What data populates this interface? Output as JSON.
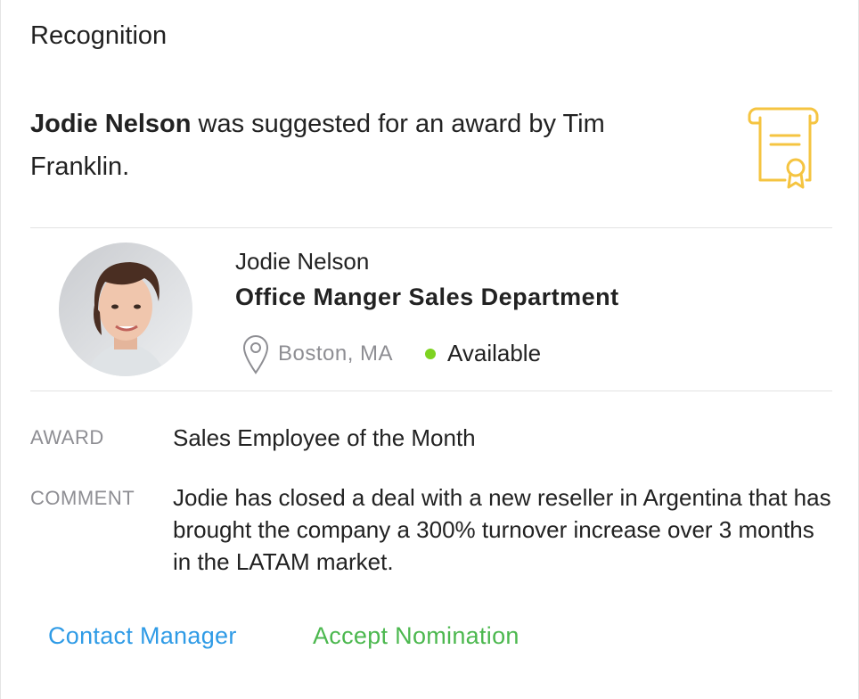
{
  "header": {
    "title": "Recognition"
  },
  "suggestion": {
    "nominee": "Jodie Nelson",
    "text": " was suggested for an award by Tim Franklin."
  },
  "colors": {
    "certificate_icon": "#f5c441",
    "contact_link": "#2f9be6",
    "accept_link": "#4cb84f",
    "status_available": "#7ed321",
    "label_gray": "#8e8e93"
  },
  "icons": {
    "certificate": "certificate-icon",
    "location": "location-pin-icon",
    "status": "status-dot-icon"
  },
  "person": {
    "name": "Jodie Nelson",
    "title": "Office Manger Sales Department",
    "location": "Boston, MA",
    "status": "Available"
  },
  "details": {
    "award_label": "AWARD",
    "award_value": "Sales Employee of the Month",
    "comment_label": "COMMENT",
    "comment_value": "Jodie has closed a deal with a new reseller in Argentina that has brought the company a 300% turnover increase over 3 months in the LATAM market."
  },
  "actions": {
    "contact_label": "Contact Manager",
    "accept_label": "Accept Nomination"
  }
}
